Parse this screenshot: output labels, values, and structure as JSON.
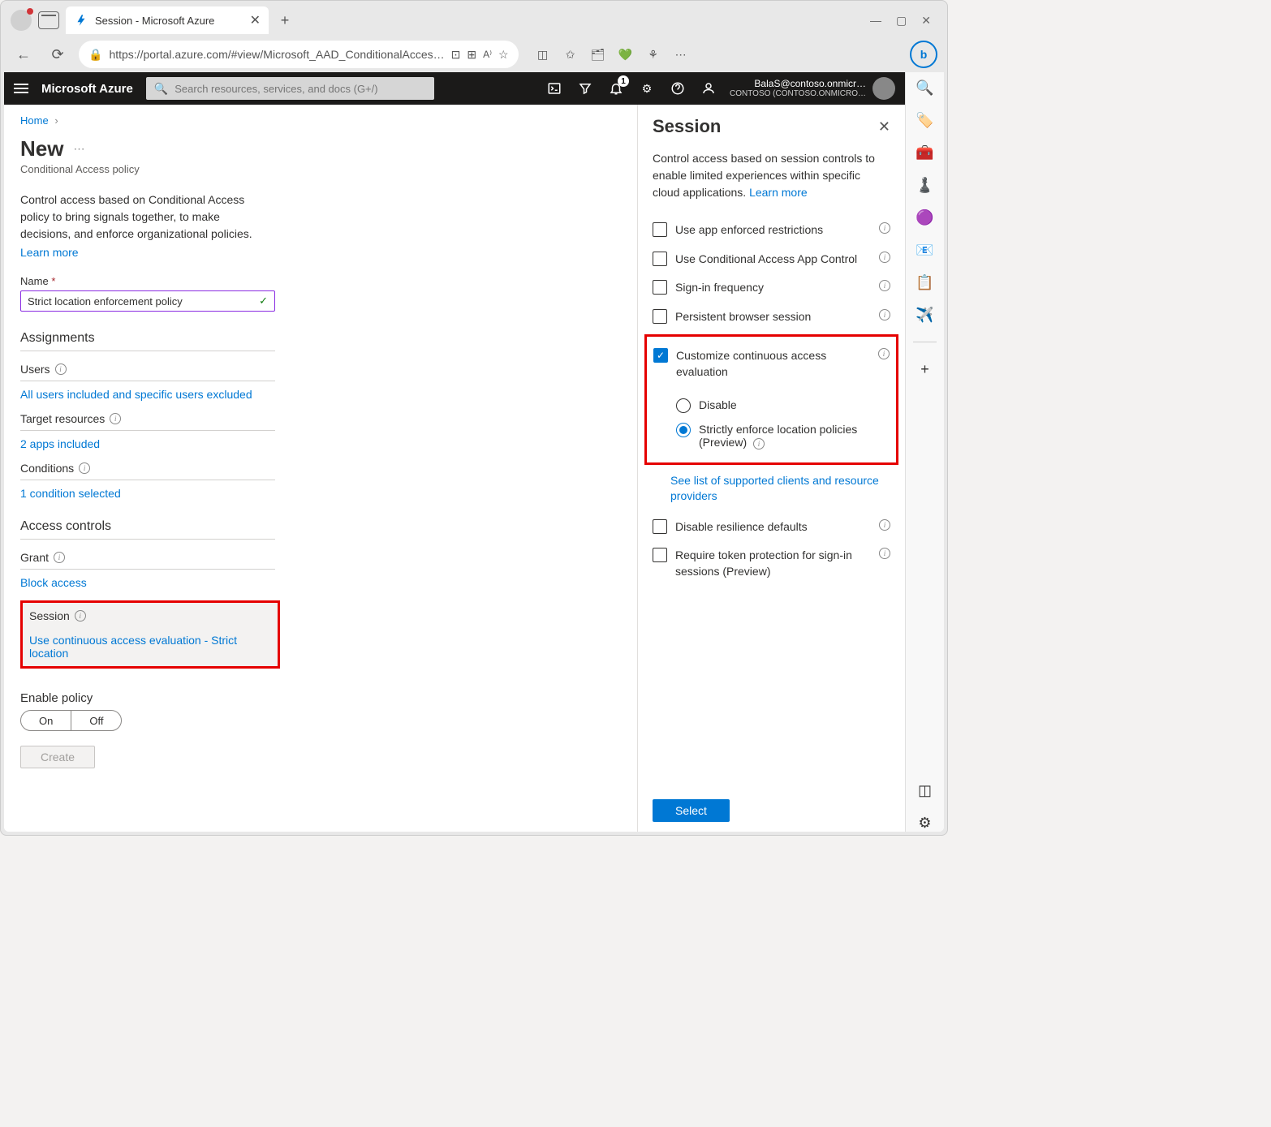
{
  "browser": {
    "tab_title": "Session - Microsoft Azure",
    "url": "https://portal.azure.com/#view/Microsoft_AAD_ConditionalAcces…"
  },
  "azure_bar": {
    "brand": "Microsoft Azure",
    "search_placeholder": "Search resources, services, and docs (G+/)",
    "notification_count": "1",
    "user_email": "BalaS@contoso.onmicr…",
    "user_org": "CONTOSO (CONTOSO.ONMICRO…"
  },
  "breadcrumb": {
    "home": "Home"
  },
  "page": {
    "title": "New",
    "subtitle": "Conditional Access policy",
    "intro": "Control access based on Conditional Access policy to bring signals together, to make decisions, and enforce organizational policies.",
    "learn_more": "Learn more"
  },
  "name_field": {
    "label": "Name",
    "value": "Strict location enforcement policy"
  },
  "sections": {
    "assignments": "Assignments",
    "access_controls": "Access controls"
  },
  "items": {
    "users": {
      "label": "Users",
      "value": "All users included and specific users excluded"
    },
    "target": {
      "label": "Target resources",
      "value": "2 apps included"
    },
    "conditions": {
      "label": "Conditions",
      "value": "1 condition selected"
    },
    "grant": {
      "label": "Grant",
      "value": "Block access"
    },
    "session": {
      "label": "Session",
      "value": "Use continuous access evaluation - Strict location"
    }
  },
  "enable_policy": {
    "label": "Enable policy",
    "on": "On",
    "off": "Off"
  },
  "create_btn": "Create",
  "panel": {
    "title": "Session",
    "intro": "Control access based on session controls to enable limited experiences within specific cloud applications.",
    "learn_more": "Learn more",
    "checks": {
      "app_enforced": "Use app enforced restrictions",
      "ca_app_control": "Use Conditional Access App Control",
      "signin_freq": "Sign-in frequency",
      "persistent": "Persistent browser session",
      "customize_cae": "Customize continuous access evaluation",
      "disable_resilience": "Disable resilience defaults",
      "token_protection": "Require token protection for sign-in sessions (Preview)"
    },
    "radios": {
      "disable": "Disable",
      "strict": "Strictly enforce location policies (Preview)"
    },
    "supported_link": "See list of supported clients and resource providers",
    "select_btn": "Select"
  }
}
